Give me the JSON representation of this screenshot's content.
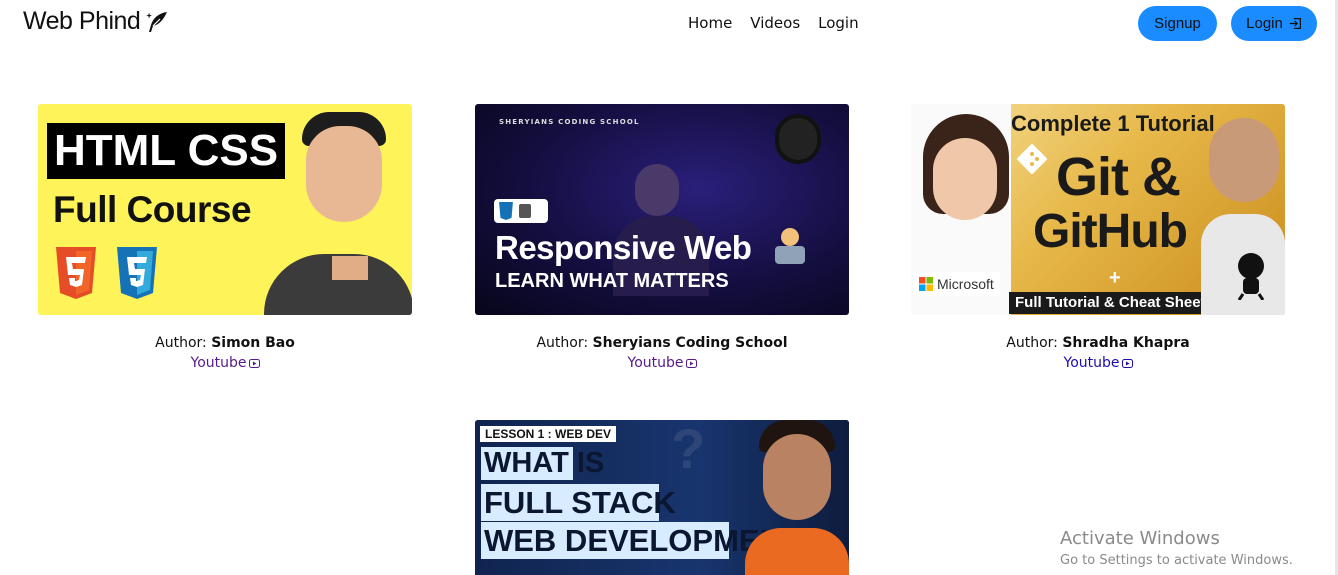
{
  "navbar": {
    "brand": "Web Phind",
    "links": [
      "Home",
      "Videos",
      "Login"
    ],
    "signup_label": "Signup",
    "login_label": "Login",
    "accent_color": "#1a8cff"
  },
  "cards": [
    {
      "author_label": "Author:",
      "author": "Simon Bao",
      "link": "Youtube",
      "thumbnail": {
        "title_line1": "HTML CSS",
        "title_line2": "Full Course"
      }
    },
    {
      "author_label": "Author:",
      "author": "Sheryians Coding School",
      "link": "Youtube",
      "thumbnail": {
        "channel": "SHERYIANS CODING SCHOOL",
        "title": "Responsive Web",
        "subtitle": "LEARN WHAT MATTERS"
      }
    },
    {
      "author_label": "Author:",
      "author": "Shradha Khapra",
      "link": "Youtube",
      "thumbnail": {
        "top": "Complete 1 Tutorial",
        "git": "Git &",
        "github": "GitHub",
        "plus": "+",
        "bottom": "Full Tutorial & Cheat Sheet",
        "sponsor": "Microsoft"
      }
    },
    {
      "thumbnail": {
        "tag": "LESSON 1 : WEB DEV",
        "line1": "WHAT IS",
        "line2": "FULL STACK",
        "line3": "WEB DEVELOPMENT?"
      }
    }
  ],
  "watermark": {
    "title": "Activate Windows",
    "subtitle": "Go to Settings to activate Windows."
  }
}
